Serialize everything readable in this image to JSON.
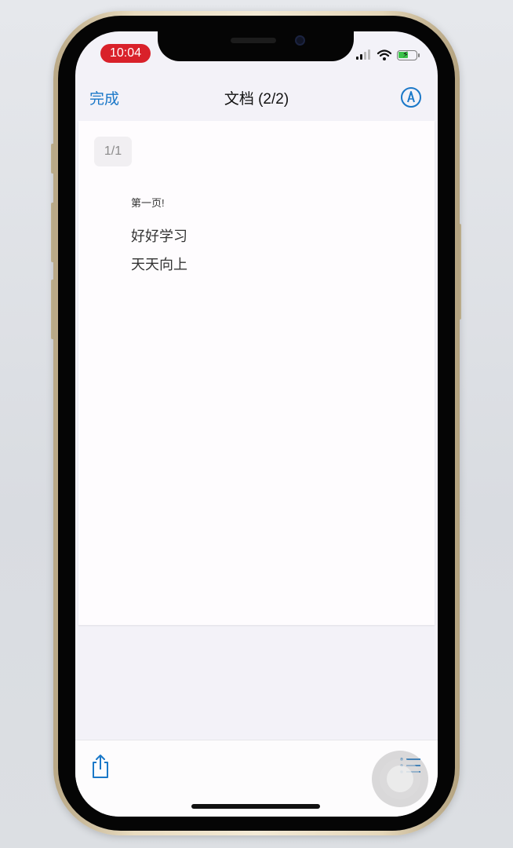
{
  "status_bar": {
    "time": "10:04",
    "time_pill_color": "#d9212a",
    "icons": [
      "signal-icon",
      "wifi-icon",
      "battery-charging-icon"
    ]
  },
  "nav": {
    "done_label": "完成",
    "title": "文档 (2/2)",
    "markup_icon": "markup-pen-icon",
    "accent_color": "#1a78c8"
  },
  "document": {
    "page_indicator": "1/1",
    "heading": "第一页!",
    "lines": [
      "好好学习",
      "天天向上"
    ]
  },
  "toolbar": {
    "share_icon": "share-icon",
    "list_icon": "list-icon"
  }
}
